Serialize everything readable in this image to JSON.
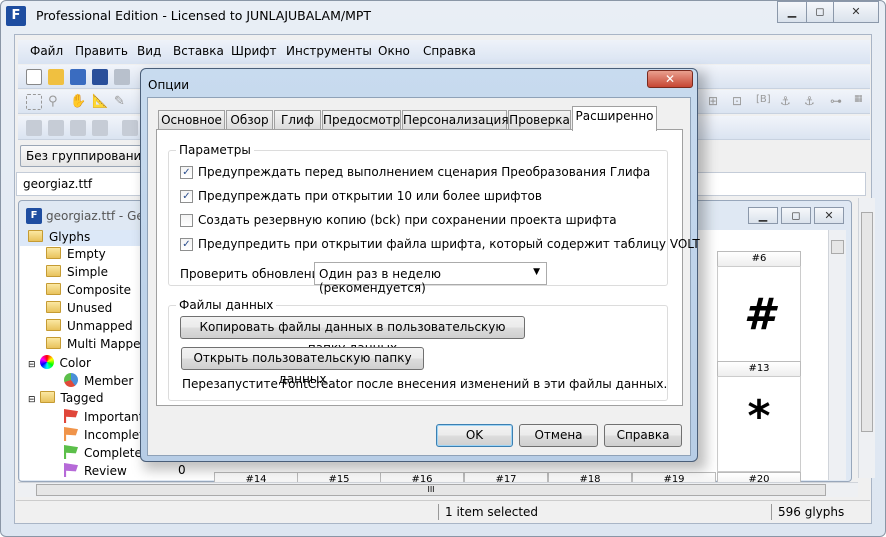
{
  "window": {
    "title": "Professional Edition - Licensed to JUNLAJUBALAM/MPT",
    "app_icon": "fontcreator-icon"
  },
  "menu": [
    "Файл",
    "Править",
    "Вид",
    "Вставка",
    "Шрифт",
    "Инструменты",
    "Окно",
    "Справка"
  ],
  "grouping": {
    "value": "Без группирования"
  },
  "file_tab": "georgiaz.ttf",
  "child": {
    "title": "georgiaz.ttf - Geo"
  },
  "tree": {
    "root": "Glyphs",
    "folders": [
      "Empty",
      "Simple",
      "Composite",
      "Unused",
      "Unmapped",
      "Multi Mapped"
    ],
    "color": "Color",
    "color_member": "Member",
    "tagged": "Tagged",
    "tags": [
      {
        "label": "Important",
        "color": "#e0463a"
      },
      {
        "label": "Incomplete",
        "color": "#f0944a"
      },
      {
        "label": "Completed",
        "color": "#5cbf4a"
      },
      {
        "label": "Review",
        "color": "#b66ad8"
      }
    ],
    "count": "0"
  },
  "grid": {
    "col6": "#6",
    "glyph6": "#",
    "col13": "#13",
    "glyph13": "*",
    "bottom_headers": [
      "#14",
      "#15",
      "#16",
      "#17",
      "#18",
      "#19",
      "#20"
    ]
  },
  "status": {
    "selection": "1 item selected",
    "count": "596 glyphs"
  },
  "dialog": {
    "title": "Опции",
    "tabs": [
      "Основное",
      "Обзор",
      "Глиф",
      "Предосмотр",
      "Персонализация",
      "Проверка",
      "Расширенно"
    ],
    "active_tab": "Расширенно",
    "params_group": "Параметры",
    "checkboxes": [
      {
        "label": "Предупреждать перед выполнением сценария Преобразования Глифа",
        "checked": true
      },
      {
        "label": "Предупреждать при открытии 10 или более шрифтов",
        "checked": true
      },
      {
        "label": "Создать резервную копию (bck) при сохранении проекта шрифта",
        "checked": false
      },
      {
        "label": "Предупредить при открытии файла шрифта, который содержит таблицу VOLT",
        "checked": true
      }
    ],
    "updates_label": "Проверить обновления:",
    "updates_value": "Один раз в неделю (рекомендуется)",
    "data_group": "Файлы данных",
    "copy_button": "Копировать файлы данных в пользовательскую папку данных",
    "open_button": "Открыть пользовательскую папку данных",
    "restart_note": "Перезапустите FontCreator после внесения изменений в эти файлы данных.",
    "ok": "OK",
    "cancel": "Отмена",
    "help": "Справка"
  }
}
